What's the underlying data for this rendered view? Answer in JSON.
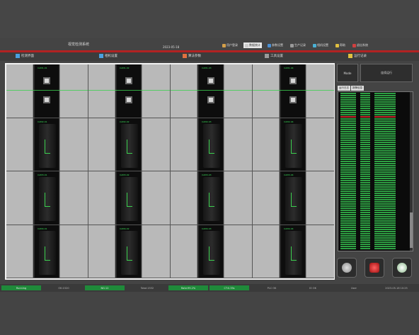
{
  "header": {
    "app_title": "视觉检测系统",
    "date_text": "2023-05-18",
    "buttons": [
      {
        "label": "用户登录",
        "icon": "user-icon",
        "color": "#d4a04a",
        "active": false
      },
      {
        "label": "数据统计",
        "icon": "chart-icon",
        "color": "#cccccc",
        "active": true
      },
      {
        "label": "参数设置",
        "icon": "gear-icon",
        "color": "#4a8fd4",
        "active": false
      },
      {
        "label": "生产记录",
        "icon": "record-icon",
        "color": "#9a9a9a",
        "active": false
      },
      {
        "label": "相机设置",
        "icon": "camera-icon",
        "color": "#4ab0d4",
        "active": false
      },
      {
        "label": "帮助",
        "icon": "help-icon",
        "color": "#e0c040",
        "active": false
      },
      {
        "label": "退出系统",
        "icon": "exit-icon",
        "color": "#d04040",
        "active": false
      }
    ]
  },
  "nav": {
    "items": [
      {
        "label": "检测界面",
        "icon": "monitor-icon",
        "color": "#4aa0e0"
      },
      {
        "label": "相机设置",
        "icon": "camera-icon",
        "color": "#4aa0e0"
      },
      {
        "label": "算法参数",
        "icon": "algorithm-icon",
        "color": "#e07040"
      },
      {
        "label": "工具设置",
        "icon": "tool-icon",
        "color": "#9a9a9a"
      },
      {
        "label": "运行记录",
        "icon": "log-icon",
        "color": "#e0c040"
      }
    ]
  },
  "cameras": [
    {
      "label": "CAM1-01",
      "kind": "sq"
    },
    {
      "label": "CAM1-02",
      "kind": "sq"
    },
    {
      "label": "CAM1-03",
      "kind": "sq"
    },
    {
      "label": "CAM1-04",
      "kind": "sq"
    },
    {
      "label": "CAM2-01",
      "kind": "tube"
    },
    {
      "label": "CAM2-02",
      "kind": "tube"
    },
    {
      "label": "CAM2-03",
      "kind": "tube"
    },
    {
      "label": "CAM2-04",
      "kind": "tube"
    },
    {
      "label": "CAM3-01",
      "kind": "tube"
    },
    {
      "label": "CAM3-02",
      "kind": "tube"
    },
    {
      "label": "CAM3-03",
      "kind": "tube"
    },
    {
      "label": "CAM3-04",
      "kind": "tube"
    },
    {
      "label": "CAM4-01",
      "kind": "tube"
    },
    {
      "label": "CAM4-02",
      "kind": "tube"
    },
    {
      "label": "CAM4-03",
      "kind": "tube"
    },
    {
      "label": "CAM4-04",
      "kind": "tube"
    }
  ],
  "right_panel": {
    "mode_label": "Mode",
    "run_label": "连续运行",
    "tabs": [
      "运行日志",
      "报警信息"
    ],
    "controls": [
      {
        "name": "start-button",
        "icon": "start-icon",
        "color": "#bfbfbf"
      },
      {
        "name": "stop-button",
        "icon": "stop-icon",
        "color": "#d03030"
      },
      {
        "name": "settings-button",
        "icon": "gear-icon",
        "color": "#e8e8e8"
      }
    ]
  },
  "statusbar": {
    "items": [
      {
        "label": "Running",
        "style": "green"
      },
      {
        "label": "OK:1520",
        "style": "plain"
      },
      {
        "label": "NG:12",
        "style": "green"
      },
      {
        "label": "Total:1532",
        "style": "plain"
      },
      {
        "label": "Rate:99.2%",
        "style": "green"
      },
      {
        "label": "CT:0.35s",
        "style": "green"
      },
      {
        "label": "PLC OK",
        "style": "plain"
      },
      {
        "label": "IO OK",
        "style": "plain"
      },
      {
        "label": "User",
        "style": "plain"
      },
      {
        "label": "2023-05-18 10:25",
        "style": "plain"
      }
    ]
  }
}
